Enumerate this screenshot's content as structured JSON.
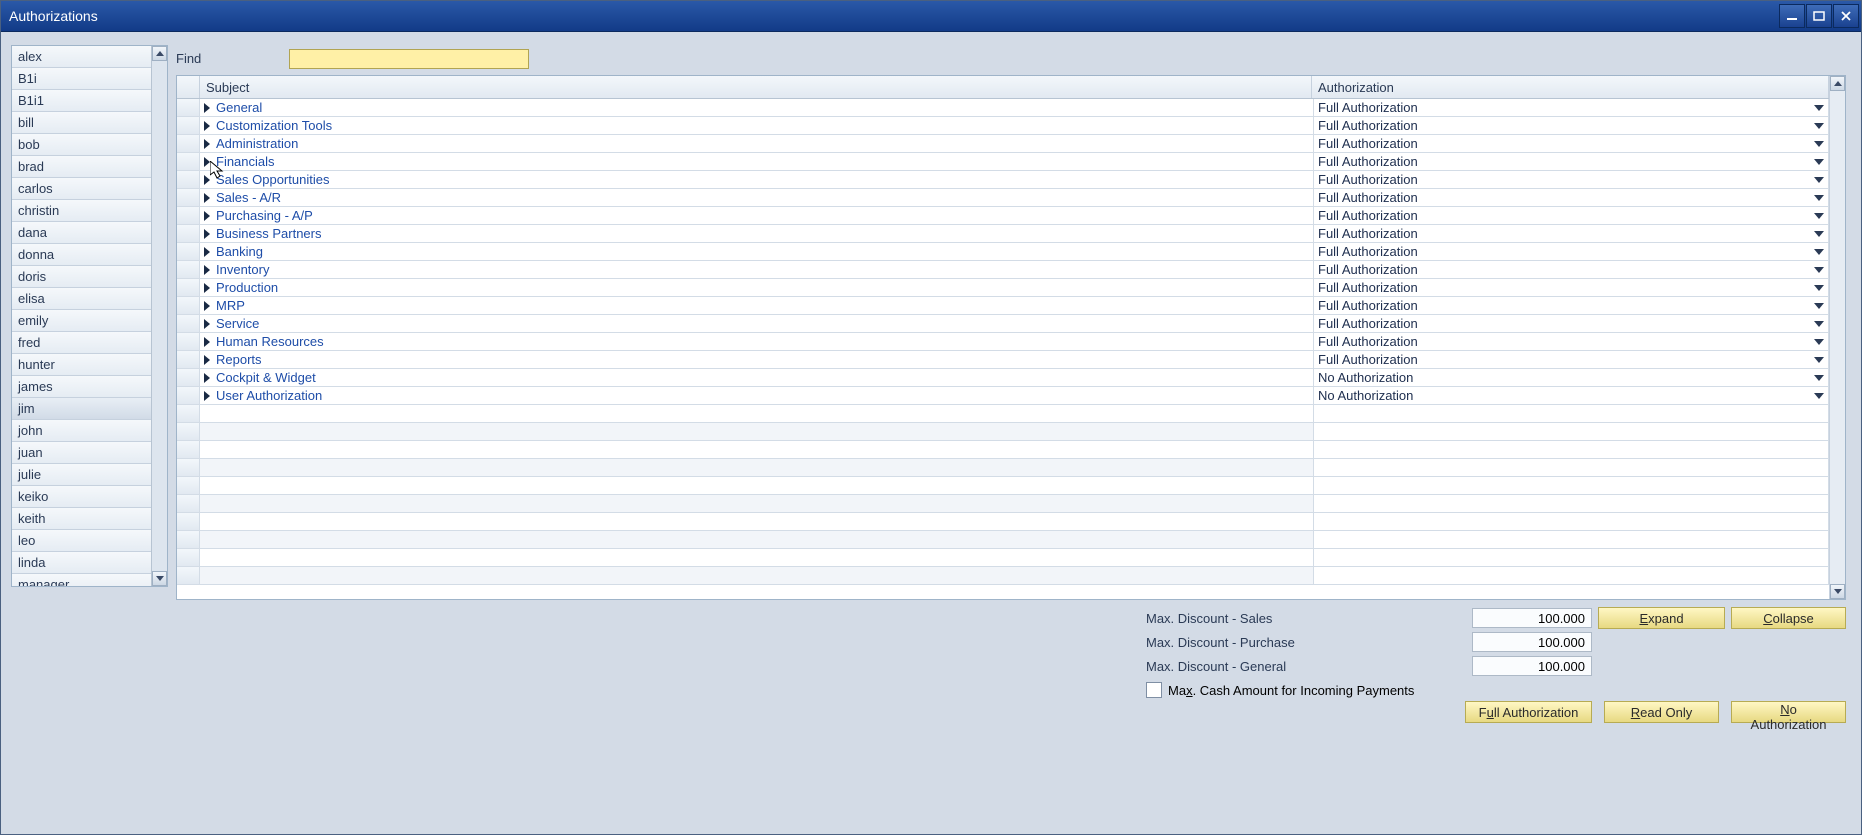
{
  "window": {
    "title": "Authorizations"
  },
  "users": [
    "alex",
    "B1i",
    "B1i1",
    "bill",
    "bob",
    "brad",
    "carlos",
    "christin",
    "dana",
    "donna",
    "doris",
    "elisa",
    "emily",
    "fred",
    "hunter",
    "james",
    "jim",
    "john",
    "juan",
    "julie",
    "keiko",
    "keith",
    "leo",
    "linda",
    "manager"
  ],
  "selected_user_index": 16,
  "find": {
    "label": "Find",
    "value": ""
  },
  "grid": {
    "columns": {
      "subject": "Subject",
      "authorization": "Authorization"
    },
    "rows": [
      {
        "subject": "General",
        "authorization": "Full Authorization"
      },
      {
        "subject": "Customization Tools",
        "authorization": "Full Authorization"
      },
      {
        "subject": "Administration",
        "authorization": "Full Authorization"
      },
      {
        "subject": "Financials",
        "authorization": "Full Authorization"
      },
      {
        "subject": "Sales Opportunities",
        "authorization": "Full Authorization"
      },
      {
        "subject": "Sales - A/R",
        "authorization": "Full Authorization"
      },
      {
        "subject": "Purchasing - A/P",
        "authorization": "Full Authorization"
      },
      {
        "subject": "Business Partners",
        "authorization": "Full Authorization"
      },
      {
        "subject": "Banking",
        "authorization": "Full Authorization"
      },
      {
        "subject": "Inventory",
        "authorization": "Full Authorization"
      },
      {
        "subject": "Production",
        "authorization": "Full Authorization"
      },
      {
        "subject": "MRP",
        "authorization": "Full Authorization"
      },
      {
        "subject": "Service",
        "authorization": "Full Authorization"
      },
      {
        "subject": "Human Resources",
        "authorization": "Full Authorization"
      },
      {
        "subject": "Reports",
        "authorization": "Full Authorization"
      },
      {
        "subject": "Cockpit & Widget",
        "authorization": "No Authorization"
      },
      {
        "subject": "User Authorization",
        "authorization": "No Authorization"
      }
    ]
  },
  "discounts": {
    "sales_label": "Max. Discount - Sales",
    "sales_value": "100.000",
    "purchase_label": "Max. Discount - Purchase",
    "purchase_value": "100.000",
    "general_label": "Max. Discount - General",
    "general_value": "100.000",
    "cash_checkbox": "Max. Cash Amount for Incoming Payments"
  },
  "buttons": {
    "expand": "Expand",
    "collapse": "Collapse",
    "full": "Full Authorization",
    "read": "Read Only",
    "none": "No Authorization"
  }
}
